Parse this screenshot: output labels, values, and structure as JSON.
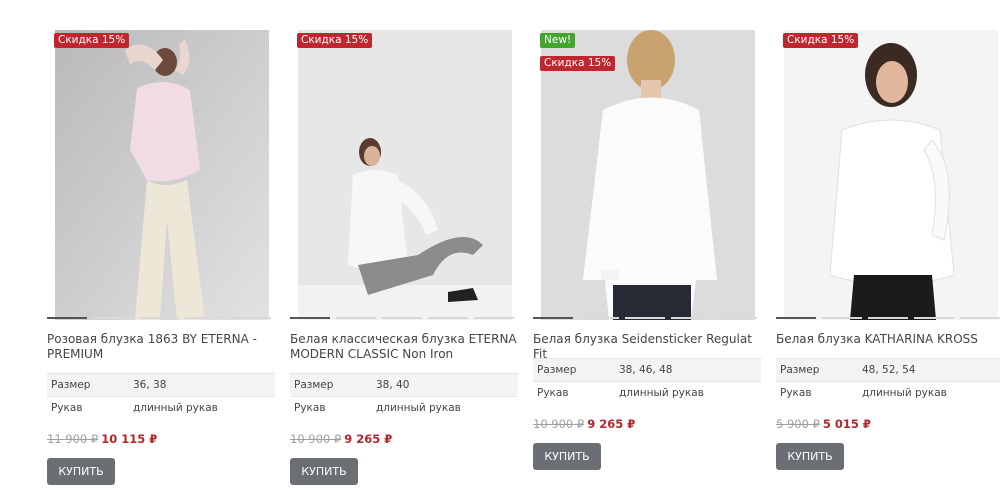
{
  "products": [
    {
      "badges": [
        "Скидка 15%"
      ],
      "title": "Розовая блузка 1863 BY ETERNA - PREMIUM",
      "specs": [
        {
          "key": "Размер",
          "value": "36, 38"
        },
        {
          "key": "Рукав",
          "value": "длинный рукав"
        }
      ],
      "old_price": "11 900 ₽",
      "new_price": "10 115 ₽",
      "buy_label": "КУПИТЬ"
    },
    {
      "badges": [
        "Скидка 15%"
      ],
      "title": "Белая классическая блузка ETERNA MODERN CLASSIC Non Iron",
      "specs": [
        {
          "key": "Размер",
          "value": "38, 40"
        },
        {
          "key": "Рукав",
          "value": "длинный рукав"
        }
      ],
      "old_price": "10 900 ₽",
      "new_price": "9 265 ₽",
      "buy_label": "КУПИТЬ"
    },
    {
      "badges": [
        "New!",
        "Скидка 15%"
      ],
      "title": "Белая блузка Seidensticker Regulat Fit",
      "specs": [
        {
          "key": "Размер",
          "value": "38, 46, 48"
        },
        {
          "key": "Рукав",
          "value": "длинный рукав"
        }
      ],
      "old_price": "10 900 ₽",
      "new_price": "9 265 ₽",
      "buy_label": "КУПИТЬ"
    },
    {
      "badges": [
        "Скидка 15%"
      ],
      "title": "Белая блузка KATHARINA KROSS",
      "specs": [
        {
          "key": "Размер",
          "value": "48, 52, 54"
        },
        {
          "key": "Рукав",
          "value": "длинный рукав"
        }
      ],
      "old_price": "5 900 ₽",
      "new_price": "5 015 ₽",
      "buy_label": "КУПИТЬ"
    }
  ],
  "colors": {
    "sale_badge": "#c0262d",
    "new_badge": "#43a62c",
    "new_price": "#b3252c",
    "buy_button": "#6b6e73"
  }
}
